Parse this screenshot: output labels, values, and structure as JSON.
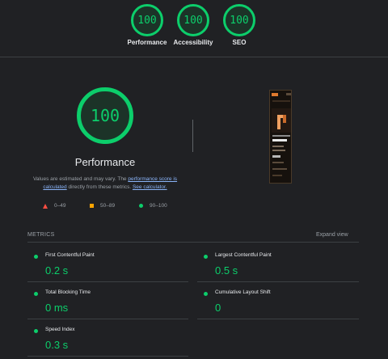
{
  "summary": [
    {
      "score": "100",
      "label": "Performance"
    },
    {
      "score": "100",
      "label": "Accessibility"
    },
    {
      "score": "100",
      "label": "SEO"
    }
  ],
  "performance": {
    "score": "100",
    "title": "Performance",
    "desc_prefix": "Values are estimated and may vary. The ",
    "desc_link1": "performance score is calculated",
    "desc_middle": " directly from these metrics. ",
    "desc_link2": "See calculator."
  },
  "legend": {
    "fail": "0–49",
    "average": "50–89",
    "pass": "90–100"
  },
  "metrics": {
    "header": "METRICS",
    "expand_label": "Expand view",
    "items": [
      {
        "name": "First Contentful Paint",
        "value": "0.2 s"
      },
      {
        "name": "Largest Contentful Paint",
        "value": "0.5 s"
      },
      {
        "name": "Total Blocking Time",
        "value": "0 ms"
      },
      {
        "name": "Cumulative Layout Shift",
        "value": "0"
      },
      {
        "name": "Speed Index",
        "value": "0.3 s"
      }
    ]
  },
  "colors": {
    "pass": "#0cce6b",
    "average": "#ffa400",
    "fail": "#ff4e42",
    "background": "#202124"
  }
}
